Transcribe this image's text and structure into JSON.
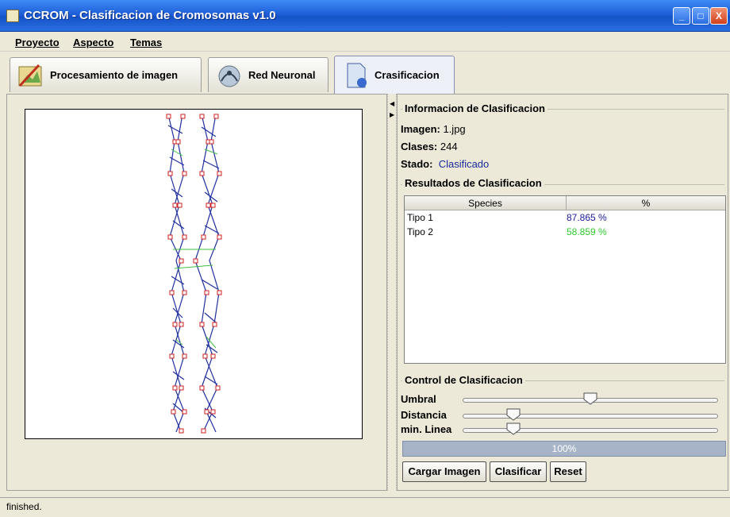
{
  "window": {
    "title": "CCROM - Clasificacion de Cromosomas v1.0",
    "minimize": "_",
    "maximize": "□",
    "close": "X"
  },
  "menu": {
    "items": [
      "Proyecto",
      "Aspecto",
      "Temas"
    ]
  },
  "tabs": [
    {
      "label": "Procesamiento de imagen",
      "icon": "image-edit-icon",
      "active": false
    },
    {
      "label": "Red Neuronal",
      "icon": "network-icon",
      "active": false
    },
    {
      "label": "Crasificacion",
      "icon": "document-icon",
      "active": true
    }
  ],
  "info": {
    "group_title": "Informacion de Clasificacion",
    "imagen_label": "Imagen:",
    "imagen_value": "1.jpg",
    "clases_label": "Clases:",
    "clases_value": "244",
    "stado_label": "Stado:",
    "stado_value": "Clasificado"
  },
  "results": {
    "group_title": "Resultados de Clasificacion",
    "columns": [
      "Species",
      "%"
    ],
    "rows": [
      {
        "species": "Tipo 1",
        "percent": "87.865 %",
        "color": "#1a1a9c"
      },
      {
        "species": "Tipo 2",
        "percent": "58.859 %",
        "color": "#2ec82e"
      }
    ]
  },
  "control": {
    "group_title": "Control de Clasificacion",
    "sliders": [
      {
        "label": "Umbral",
        "level": 0.5
      },
      {
        "label": "Distancia",
        "level": 0.2
      },
      {
        "label": "min. Linea",
        "level": 0.2
      }
    ],
    "progress_text": "100%",
    "progress": 1.0,
    "buttons": [
      "Cargar Imagen",
      "Clasificar",
      "Reset"
    ]
  },
  "status": {
    "text": "finished."
  }
}
